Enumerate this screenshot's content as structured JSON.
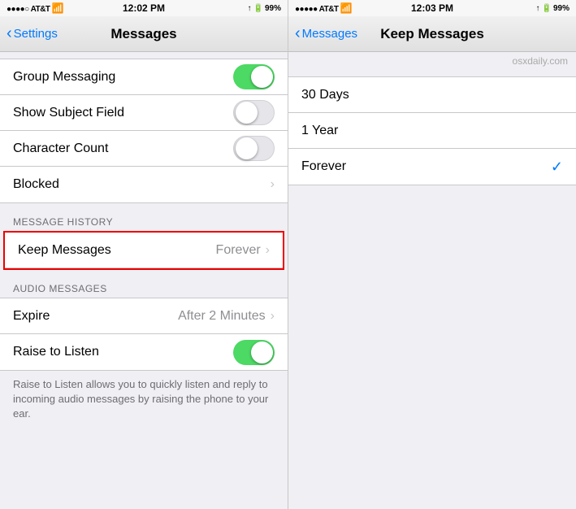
{
  "left": {
    "statusBar": {
      "carrier": "●●●●○ AT&T",
      "wifi": "▼",
      "time": "12:02 PM",
      "signal": "↑",
      "battery_icon": "▐",
      "battery": "99%"
    },
    "navBar": {
      "backLabel": "Settings",
      "title": "Messages"
    },
    "rows": [
      {
        "label": "Group Messaging",
        "toggle": true,
        "toggleOn": true
      },
      {
        "label": "Show Subject Field",
        "toggle": true,
        "toggleOn": false
      },
      {
        "label": "Character Count",
        "toggle": true,
        "toggleOn": false
      },
      {
        "label": "Blocked",
        "chevron": true
      }
    ],
    "messageHistorySection": {
      "header": "MESSAGE HISTORY",
      "rows": [
        {
          "label": "Keep Messages",
          "value": "Forever",
          "chevron": true
        }
      ]
    },
    "audioMessagesSection": {
      "header": "AUDIO MESSAGES",
      "rows": [
        {
          "label": "Expire",
          "value": "After 2 Minutes",
          "chevron": true
        },
        {
          "label": "Raise to Listen",
          "toggle": true,
          "toggleOn": true
        }
      ]
    },
    "description": "Raise to Listen allows you to quickly listen and reply to incoming audio messages by raising the phone to your ear."
  },
  "right": {
    "statusBar": {
      "carrier": "●●●●● AT&T",
      "wifi": "▼",
      "time": "12:03 PM",
      "signal": "↑",
      "battery": "99%"
    },
    "navBar": {
      "backLabel": "Messages",
      "title": "Keep Messages"
    },
    "watermark": "osxdaily.com",
    "options": [
      {
        "label": "30 Days",
        "selected": false
      },
      {
        "label": "1 Year",
        "selected": false
      },
      {
        "label": "Forever",
        "selected": true
      }
    ]
  }
}
